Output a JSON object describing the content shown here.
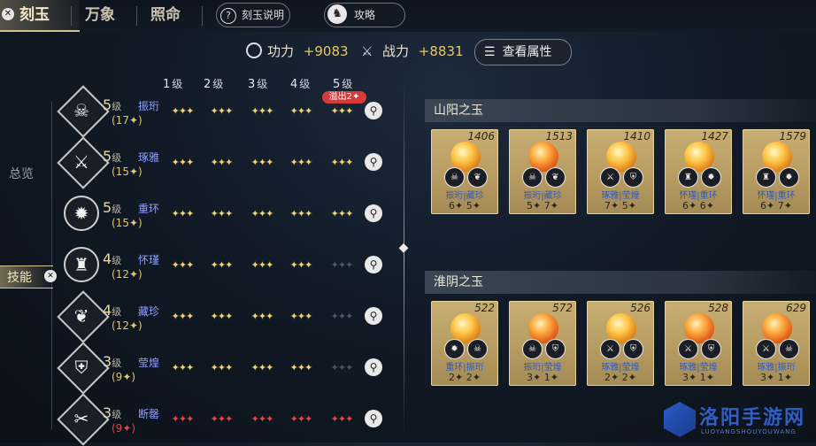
{
  "nav": {
    "tabs": [
      "刻玉",
      "万象",
      "照命"
    ],
    "help_label": "刻玉说明",
    "guide_label": "攻略"
  },
  "stats": {
    "power_label": "功力",
    "power_value": "+9083",
    "combat_label": "战力",
    "combat_value": "+8831",
    "attr_button": "查看属性"
  },
  "sidebar": {
    "items": [
      "总览",
      "技能"
    ],
    "active": "技能"
  },
  "level_header": {
    "levels": [
      "1",
      "2",
      "3",
      "4",
      "5"
    ],
    "suffix": "级",
    "overflow_badge": "溢出2✦"
  },
  "skills": [
    {
      "level": "5",
      "unit": "级",
      "name": "振珩",
      "count": "(17✦)",
      "icon": "skull-mask-icon",
      "stars": [
        3,
        3,
        3,
        3,
        3
      ],
      "state": "gold"
    },
    {
      "level": "5",
      "unit": "级",
      "name": "琢雅",
      "count": "(15✦)",
      "icon": "swords-icon",
      "stars": [
        3,
        3,
        3,
        3,
        3
      ],
      "state": "gold"
    },
    {
      "level": "5",
      "unit": "级",
      "name": "重环",
      "count": "(15✦)",
      "icon": "burst-icon",
      "stars": [
        3,
        3,
        3,
        3,
        3
      ],
      "state": "gold"
    },
    {
      "level": "4",
      "unit": "级",
      "name": "怀瑾",
      "count": "(12✦)",
      "icon": "helmet-icon",
      "stars": [
        3,
        3,
        3,
        3,
        3
      ],
      "state": "gold4"
    },
    {
      "level": "4",
      "unit": "级",
      "name": "藏珍",
      "count": "(12✦)",
      "icon": "phoenix-icon",
      "stars": [
        3,
        3,
        3,
        3,
        3
      ],
      "state": "gold4"
    },
    {
      "level": "3",
      "unit": "级",
      "name": "莹煌",
      "count": "(9✦)",
      "icon": "shield-icon",
      "stars": [
        3,
        3,
        3,
        3,
        3
      ],
      "state": "gold4"
    },
    {
      "level": "3",
      "unit": "级",
      "name": "断罄",
      "count": "(9✦)",
      "icon": "blade-icon",
      "stars": [
        3,
        3,
        3,
        3,
        3
      ],
      "state": "red"
    }
  ],
  "sections": [
    {
      "title": "山阳之玉",
      "cards": [
        {
          "num": "1406",
          "names": "振珩|藏珍",
          "vals": "6✦  5✦",
          "gem": "y"
        },
        {
          "num": "1513",
          "names": "振珩|藏珍",
          "vals": "5✦  7✦",
          "gem": "o"
        },
        {
          "num": "1410",
          "names": "琢雅|莹煌",
          "vals": "7✦  5✦",
          "gem": "y"
        },
        {
          "num": "1427",
          "names": "怀瑾|重环",
          "vals": "6✦  6✦",
          "gem": "y"
        },
        {
          "num": "1579",
          "names": "怀瑾|重环",
          "vals": "6✦  7✦",
          "gem": "y"
        }
      ]
    },
    {
      "title": "淮阴之玉",
      "cards": [
        {
          "num": "522",
          "names": "重环|振珩",
          "vals": "2✦  2✦",
          "gem": "y"
        },
        {
          "num": "572",
          "names": "振珩|莹煌",
          "vals": "3✦  1✦",
          "gem": "o"
        },
        {
          "num": "526",
          "names": "琢雅|莹煌",
          "vals": "2✦  2✦",
          "gem": "y"
        },
        {
          "num": "528",
          "names": "琢雅|莹煌",
          "vals": "3✦  1✦",
          "gem": "o"
        },
        {
          "num": "629",
          "names": "琢雅|振珩",
          "vals": "3✦  1✦",
          "gem": "o"
        }
      ]
    }
  ],
  "watermark": {
    "title": "洛阳手游网",
    "subtitle": "LUOYANGSHOUYOUWANG"
  }
}
